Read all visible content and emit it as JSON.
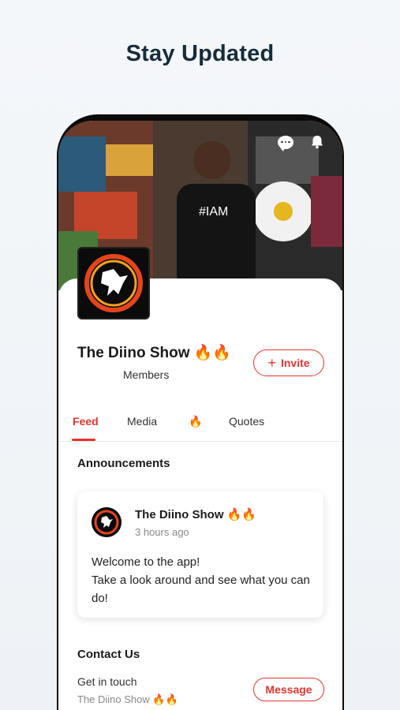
{
  "headline": "Stay Updated",
  "profile": {
    "name": "The Diino Show 🔥🔥",
    "members_label": "Members",
    "invite_label": "Invite"
  },
  "tabs": [
    {
      "label": "Feed",
      "active": true
    },
    {
      "label": "Media",
      "active": false
    },
    {
      "label": "🔥",
      "active": false
    },
    {
      "label": "Quotes",
      "active": false
    }
  ],
  "announcements": {
    "title": "Announcements",
    "post": {
      "author": "The Diino Show 🔥🔥",
      "time": "3 hours ago",
      "line1": "Welcome to the app!",
      "line2": "Take a look around and see what you can do!"
    }
  },
  "contact": {
    "title": "Contact Us",
    "label": "Get in touch",
    "sub": "The Diino Show 🔥🔥",
    "button": "Message"
  },
  "colors": {
    "accent": "#e8322e",
    "headline": "#162d3a"
  },
  "icons": {
    "chat": "chat-bubble-icon",
    "bell": "bell-icon"
  }
}
